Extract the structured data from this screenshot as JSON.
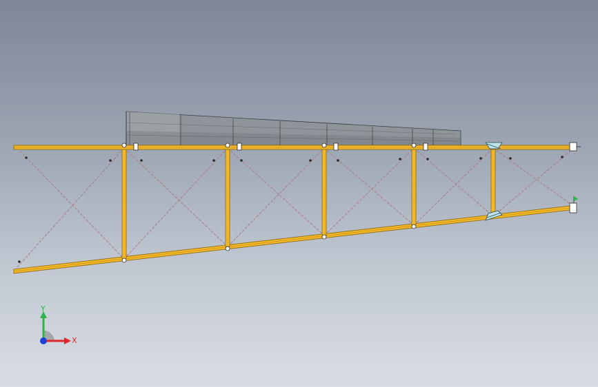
{
  "view": {
    "background_top": "#7d8796",
    "background_bottom": "#d9dde3"
  },
  "colors": {
    "member": "#f2b62a",
    "member_edge": "#8a6a10",
    "brace": "#a67a86",
    "blade": "#8e949a",
    "blade_edge": "#3a3d40",
    "joint": "#bfe3ea"
  },
  "triad": {
    "x_label": "X",
    "y_label": "Y",
    "x_color": "#e0262a",
    "y_color": "#2fb24a",
    "z_color": "#1f3fd8"
  }
}
